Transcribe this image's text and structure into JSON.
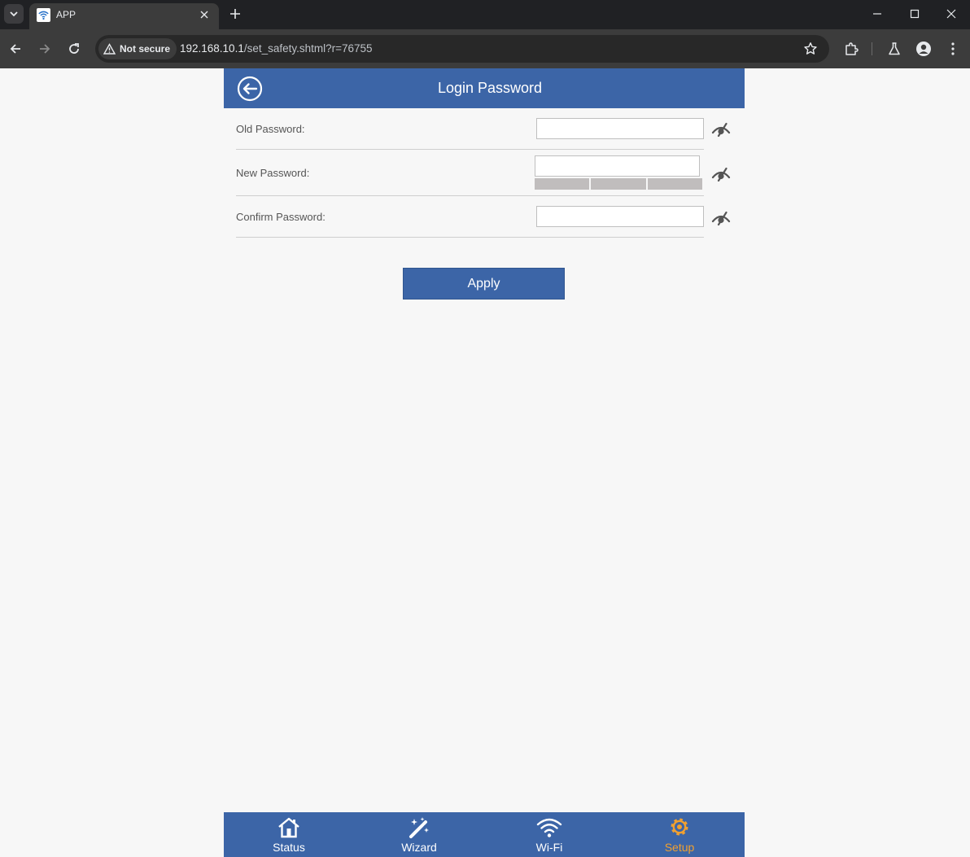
{
  "browser": {
    "tab_title": "APP",
    "security_label": "Not secure",
    "url_host": "192.168.10.1",
    "url_path": "/set_safety.shtml?r=76755"
  },
  "header": {
    "title": "Login Password"
  },
  "form": {
    "old_password": {
      "label": "Old Password:",
      "value": ""
    },
    "new_password": {
      "label": "New Password:",
      "value": ""
    },
    "confirm_password": {
      "label": "Confirm Password:",
      "value": ""
    },
    "apply_label": "Apply"
  },
  "bottom_nav": {
    "items": [
      {
        "label": "Status",
        "icon": "home-icon"
      },
      {
        "label": "Wizard",
        "icon": "magic-wand-icon"
      },
      {
        "label": "Wi-Fi",
        "icon": "wifi-icon"
      },
      {
        "label": "Setup",
        "icon": "gear-icon"
      }
    ],
    "active": "Setup",
    "active_color": "#f0a030"
  },
  "colors": {
    "brand_blue": "#3c65a7",
    "background": "#f7f7f7"
  }
}
